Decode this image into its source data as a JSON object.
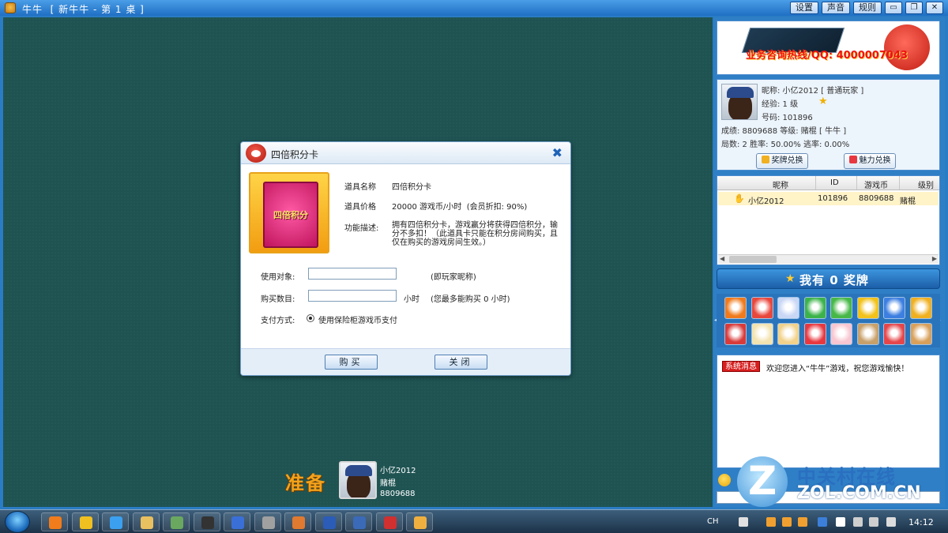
{
  "window": {
    "title": "牛牛  [ 新牛牛 - 第 1 桌 ]",
    "buttons": [
      "设置",
      "声音",
      "规则"
    ],
    "controls": [
      "▭",
      "❐",
      "✕"
    ]
  },
  "dialog": {
    "title": "四倍积分卡",
    "card_text": "四倍积分",
    "item_name_label": "道具名称",
    "item_name": "四倍积分卡",
    "price_label": "道具价格",
    "price": "20000 游戏币/小时  (会员折扣: 90%)",
    "desc_label": "功能描述:",
    "desc": "拥有四倍积分卡，游戏赢分将获得四倍积分，输分不多扣！（此道具卡只能在积分房间购买，且仅在购买的游戏房间生效。）",
    "target_label": "使用对象:",
    "target_value": "",
    "target_note": "(即玩家昵称)",
    "qty_label": "购买数目:",
    "qty_value": "",
    "qty_unit": "小时",
    "qty_note": "(您最多能购买 0 小时)",
    "pay_label": "支付方式:",
    "pay_option": "使用保险柜游戏币支付",
    "buy_button": "购买",
    "close_button": "关闭"
  },
  "player": {
    "ready_text": "准备",
    "name": "小亿2012",
    "title": "赌棍",
    "coins": "8809688"
  },
  "right_panel": {
    "banner_text": "业务咨询热线/QQ: 4000007043",
    "user": {
      "nickname": "昵称: 小亿2012 [ 普通玩家 ]",
      "exp": "经验: 1 级",
      "id": "号码: 101896",
      "score": "成绩: 8809688 等级: 赌棍 [ 牛牛 ]",
      "stats": "局数: 2 胜率: 50.00% 逃率: 0.00%",
      "btn_medal": "奖牌兑换",
      "btn_charm": "魅力兑换"
    },
    "list": {
      "headers": [
        "昵称",
        "ID",
        "游戏币",
        "级别"
      ],
      "rows": [
        {
          "name": "小亿2012",
          "id": "101896",
          "coins": "8809688",
          "level": "赌棍"
        }
      ]
    },
    "medal_text": "我有 0 奖牌",
    "item_colors": [
      "#f07a1c",
      "#e8473c",
      "#c9d7f5",
      "#3cb34a",
      "#47b847",
      "#f2c21b",
      "#3d7fe0",
      "#f0b020",
      "#d93a3a",
      "#f3e3b0",
      "#f2d28a",
      "#e8383f",
      "#f7c6d0",
      "#c8a06a",
      "#e5464a",
      "#d9a05a"
    ],
    "chat": {
      "tag": "系统消息",
      "message": "欢迎您进入“牛牛”游戏，祝您游戏愉快！"
    },
    "watermark_cn": "中关村在线",
    "watermark_en": "ZOL.COM.CN"
  },
  "taskbar": {
    "lang": "CH",
    "time": "14:12",
    "task_colors": [
      "#f07c1b",
      "#f0c020",
      "#3ca0f0",
      "#e8c060",
      "#6aa860",
      "#333333",
      "#3b6fd8",
      "#a0a0a0",
      "#e07a30",
      "#2b5cb8",
      "#3a6ab8",
      "#d03030",
      "#f0b040"
    ]
  }
}
